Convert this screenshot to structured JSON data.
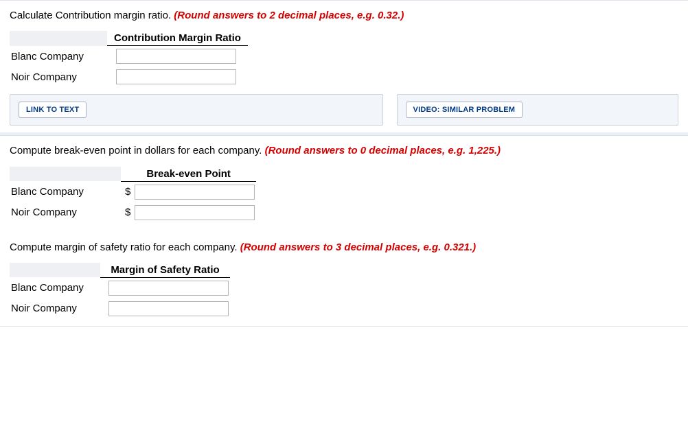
{
  "sections": {
    "s1": {
      "prompt_plain": "Calculate Contribution margin ratio. ",
      "prompt_instr": "(Round answers to 2 decimal places, e.g. 0.32.)",
      "col_header": "Contribution Margin Ratio",
      "rows": {
        "r1": {
          "label": "Blanc Company",
          "prefix": ""
        },
        "r2": {
          "label": "Noir Company",
          "prefix": ""
        }
      }
    },
    "s2": {
      "prompt_plain": "Compute break-even point in dollars for each company. ",
      "prompt_instr": "(Round answers to 0 decimal places, e.g. 1,225.)",
      "col_header": "Break-even Point",
      "rows": {
        "r1": {
          "label": "Blanc Company",
          "prefix": "$"
        },
        "r2": {
          "label": "Noir Company",
          "prefix": "$"
        }
      }
    },
    "s3": {
      "prompt_plain": "Compute margin of safety ratio for each company. ",
      "prompt_instr": "(Round answers to 3 decimal places, e.g. 0.321.)",
      "col_header": "Margin of Safety Ratio",
      "rows": {
        "r1": {
          "label": "Blanc Company",
          "prefix": ""
        },
        "r2": {
          "label": "Noir Company",
          "prefix": ""
        }
      }
    }
  },
  "buttons": {
    "link_to_text": "LINK TO TEXT",
    "video_similar": "VIDEO: SIMILAR PROBLEM"
  }
}
